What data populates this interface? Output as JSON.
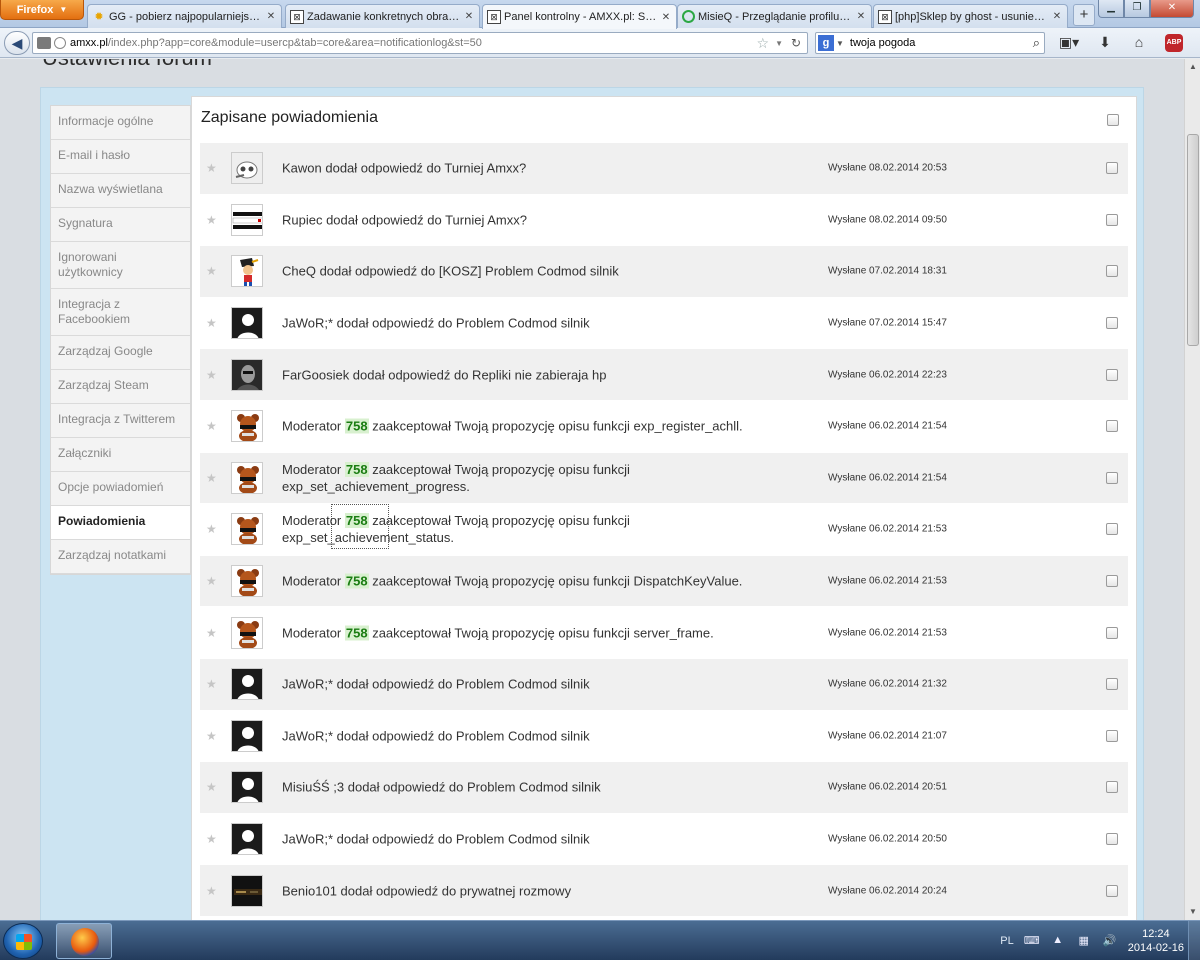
{
  "browser": {
    "menu_label": "Firefox",
    "tabs": [
      {
        "label": "GG - pobierz najpopularniejszy p...",
        "icon": "sun-icon"
      },
      {
        "label": "Zadawanie konkretnych obrażeń...",
        "icon": "box-icon"
      },
      {
        "label": "Panel kontrolny - AMXX.pl: Supp...",
        "icon": "box-icon",
        "active": true
      },
      {
        "label": "MisieQ - Przeglądanie profilu - A...",
        "icon": "ring-icon"
      },
      {
        "label": "[php]Sklep by ghost - usuniecie ...",
        "icon": "box-icon"
      }
    ],
    "url_domain": "amxx.pl",
    "url_path": "/index.php?app=core&module=usercp&tab=core&area=notificationlog&st=50",
    "search_value": "twoja pogoda"
  },
  "page": {
    "title": "Ustawienia forum",
    "content_title": "Zapisane powiadomienia"
  },
  "sidebar": {
    "items": [
      {
        "label": "Informacje ogólne"
      },
      {
        "label": "E-mail i hasło"
      },
      {
        "label": "Nazwa wyświetlana"
      },
      {
        "label": "Sygnatura"
      },
      {
        "label": "Ignorowani użytkownicy"
      },
      {
        "label": "Integracja z Facebookiem"
      },
      {
        "label": "Zarządzaj Google"
      },
      {
        "label": "Zarządzaj Steam"
      },
      {
        "label": "Integracja z Twitterem"
      },
      {
        "label": "Załączniki"
      },
      {
        "label": "Opcje powiadomień"
      },
      {
        "label": "Powiadomienia",
        "active": true
      },
      {
        "label": "Zarządzaj notatkami"
      }
    ]
  },
  "notifications": [
    {
      "avatar": "avatar-skull",
      "text": "Kawon dodał odpowiedź do Turniej Amxx?",
      "date": "Wysłane 08.02.2014 20:53"
    },
    {
      "avatar": "avatar-banner",
      "text": "Rupiec dodał odpowiedź do Turniej Amxx?",
      "date": "Wysłane 08.02.2014 09:50"
    },
    {
      "avatar": "avatar-cartoon",
      "text": "CheQ dodał odpowiedź do [KOSZ] Problem Codmod silnik",
      "date": "Wysłane 07.02.2014 18:31"
    },
    {
      "avatar": "avatar-default",
      "text": "JaWoR;* dodał odpowiedź do Problem Codmod silnik",
      "date": "Wysłane 07.02.2014 15:47"
    },
    {
      "avatar": "avatar-photo",
      "text": "FarGoosiek dodał odpowiedź do Repliki nie zabieraja hp",
      "date": "Wysłane 06.02.2014 22:23"
    },
    {
      "avatar": "avatar-bear",
      "pre": "Moderator ",
      "num": "758",
      "text": " zaakceptował Twoją propozycję opisu funkcji exp_register_achll.",
      "date": "Wysłane 06.02.2014 21:54"
    },
    {
      "avatar": "avatar-bear",
      "pre": "Moderator ",
      "num": "758",
      "text": " zaakceptował Twoją propozycję opisu funkcji exp_set_achievement_progress.",
      "date": "Wysłane 06.02.2014 21:54"
    },
    {
      "avatar": "avatar-bear",
      "pre": "Moderator ",
      "num": "758",
      "text": " zaakceptował Twoją propozycję opisu funkcji exp_set_achievement_status.",
      "date": "Wysłane 06.02.2014 21:53"
    },
    {
      "avatar": "avatar-bear",
      "pre": "Moderator ",
      "num": "758",
      "text": " zaakceptował Twoją propozycję opisu funkcji DispatchKeyValue.",
      "date": "Wysłane 06.02.2014 21:53"
    },
    {
      "avatar": "avatar-bear",
      "pre": "Moderator ",
      "num": "758",
      "text": " zaakceptował Twoją propozycję opisu funkcji server_frame.",
      "date": "Wysłane 06.02.2014 21:53"
    },
    {
      "avatar": "avatar-default",
      "text": "JaWoR;* dodał odpowiedź do Problem Codmod silnik",
      "date": "Wysłane 06.02.2014 21:32"
    },
    {
      "avatar": "avatar-default",
      "text": "JaWoR;* dodał odpowiedź do Problem Codmod silnik",
      "date": "Wysłane 06.02.2014 21:07"
    },
    {
      "avatar": "avatar-default",
      "text": "MisiuŚŚ ;3 dodał odpowiedź do Problem Codmod silnik",
      "date": "Wysłane 06.02.2014 20:51"
    },
    {
      "avatar": "avatar-default",
      "text": "JaWoR;* dodał odpowiedź do Problem Codmod silnik",
      "date": "Wysłane 06.02.2014 20:50"
    },
    {
      "avatar": "avatar-dark",
      "text": "Benio101 dodał odpowiedź do prywatnej rozmowy",
      "date": "Wysłane 06.02.2014 20:24"
    }
  ],
  "taskbar": {
    "lang": "PL",
    "time": "12:24",
    "date": "2014-02-16"
  },
  "colors": {
    "accent_panel": "#cce4f2",
    "number_highlight": "#1a7d12"
  }
}
